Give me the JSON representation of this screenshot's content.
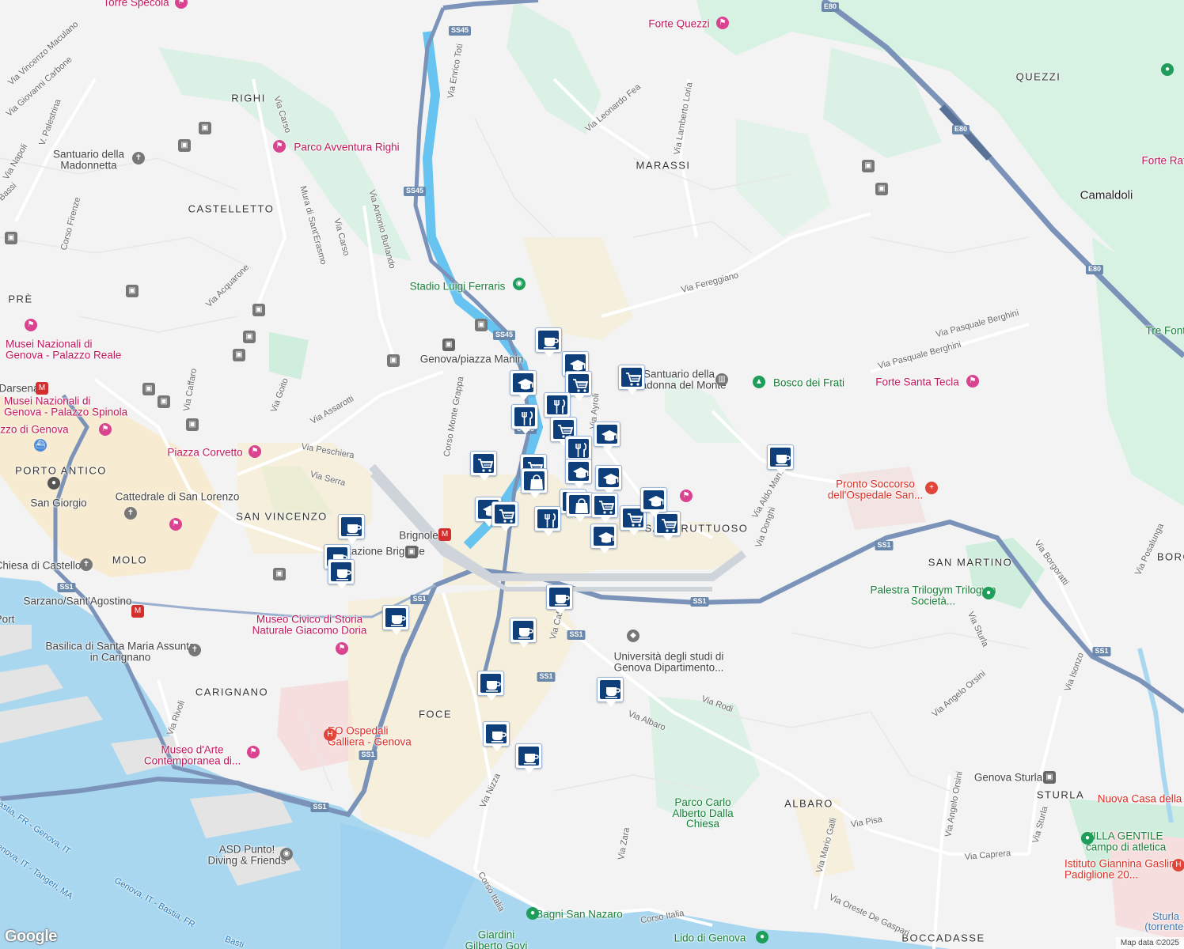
{
  "map": {
    "provider_logo": "Google",
    "copyright": "Map data ©2025",
    "colors": {
      "land": "#f3f3f3",
      "water": "#a9d7f0",
      "water_inner": "#67c3ef",
      "park": "#cfeedd",
      "urban": "#f7ecd1",
      "highway": "#7b93b8",
      "road": "#ffffff",
      "marker": "#0f3f7a",
      "hospital": "#f6dede"
    }
  },
  "labels": {
    "areas": [
      "RIGHI",
      "CASTELLETTO",
      "PRÈ",
      "MARASSI",
      "QUEZZI",
      "PORTO ANTICO",
      "SAN VINCENZO",
      "MOLO",
      "CARIGNANO",
      "FOCE",
      "SAN MARTINO",
      "ALBARO",
      "STURLA",
      "BOCCADASSE",
      "BORG",
      "SAN FRUTTUOSO"
    ],
    "cities": [
      "Camaldoli"
    ],
    "streets": [
      "Via Vincenzo Maculano",
      "Via Giovanni Carbone",
      "V. Palestrina",
      "Via Napoli",
      "Bassi",
      "Via Carso",
      "Corso Firenze",
      "Mura di Sant'Erasmo",
      "Via Carso",
      "Via Antonio Burlando",
      "Via Enrico Toti",
      "Via Leonardo Fea",
      "Via Lamberto Loria",
      "Via Acquarone",
      "Via Caffaro",
      "Via Goito",
      "Via Assarotti",
      "Via Peschiera",
      "Via Serra",
      "Corso Monte Grappa",
      "Via Fereggiano",
      "Via Pasquale Berghini",
      "Via Pasquale Berghini",
      "Via Aldo Manuzio",
      "Via Donghi",
      "Via Sturla",
      "Via Angelo Orsini",
      "Via Isonzo",
      "Via Posalunga",
      "Via Borgoratti",
      "Via Rodi",
      "Via Albaro",
      "Via Nizza",
      "Via Rivoli",
      "Via Zara",
      "Via Mario Galli",
      "Via Pisa",
      "Via Caprera",
      "Via Oreste De Gaspari",
      "Via Sturla",
      "Via Angelo Orsini",
      "Corso Italia",
      "Corso Italia",
      "Via Ayroli",
      "Via Caff"
    ],
    "ferries": [
      "Bastia, FR - Genova, IT",
      "Genova, IT - Tangeri, MA",
      "Genova, IT - Bastia, FR",
      "Basti"
    ],
    "pois_pink": [
      "Torre Specola",
      "Forte Quezzi",
      "Parco Avventura Righi",
      "Musei Nazionali di Genova - Palazzo Reale",
      "Musei Nazionali di Genova - Palazzo Spinola",
      "Palazzo di Genova",
      "Piazza Corvetto",
      "Forte Santa Tecla",
      "Museo Civico di Storia Naturale Giacomo Doria",
      "Museo d'Arte Contemporanea di...",
      "Forte Ratti"
    ],
    "pois_dark": [
      "Santuario della Madonnetta",
      "Santuario della Madonna del Monte",
      "Cattedrale di San Lorenzo",
      "Basilica di Santa Maria Assunta in Carignano",
      "Chiesa di Castello",
      "Sarzano/Sant'Agostino",
      "San Giorgio",
      "Darsena",
      "Genova/piazza Manin",
      "Brignole",
      "Stazione Brignole",
      "Università degli studi di Genova Dipartimento...",
      "ASD Punto! Diving & Friends",
      "Genova Sturla",
      "Port"
    ],
    "pois_green": [
      "Stadio Luigi Ferraris",
      "Bosco dei Frati",
      "Palestra Trilogym Trilogym Società...",
      "Parco Carlo Alberto Dalla Chiesa",
      "Bagni San Nazaro",
      "Lido di Genova",
      "VILLA GENTILE campo di atletica",
      "Giardini Gilberto Govi",
      "Tre Fontane"
    ],
    "pois_red": [
      "Pronto Soccorso dell'Ospedale San...",
      "EO Ospedali Galliera - Genova",
      "Nuova Casa della",
      "Istituto Giannina Gaslini Padiglione 20..."
    ],
    "water": [
      "Sturla (torrente)"
    ],
    "shields": [
      "SS45",
      "SS45",
      "SS45",
      "SS45",
      "SS1",
      "SS1",
      "SS1",
      "SS1",
      "SS1",
      "SS1",
      "SS1",
      "SS1",
      "E80",
      "E80",
      "E80"
    ]
  },
  "markers": [
    {
      "type": "cafe-icon"
    },
    {
      "type": "school-icon"
    },
    {
      "type": "cart-icon"
    },
    {
      "type": "cart-icon"
    },
    {
      "type": "school-icon"
    },
    {
      "type": "restaurant-icon"
    },
    {
      "type": "restaurant-icon"
    },
    {
      "type": "cart-icon"
    },
    {
      "type": "school-icon"
    },
    {
      "type": "restaurant-icon"
    },
    {
      "type": "school-icon"
    },
    {
      "type": "cart-icon"
    },
    {
      "type": "cart-icon"
    },
    {
      "type": "shopping-bag-icon"
    },
    {
      "type": "school-icon"
    },
    {
      "type": "cart-icon"
    },
    {
      "type": "school-icon"
    },
    {
      "type": "restaurant-icon"
    },
    {
      "type": "shopping-bag-icon"
    },
    {
      "type": "cart-icon"
    },
    {
      "type": "school-icon"
    },
    {
      "type": "cart-icon"
    },
    {
      "type": "cart-icon"
    },
    {
      "type": "school-icon"
    },
    {
      "type": "cafe-icon"
    },
    {
      "type": "cafe-icon"
    },
    {
      "type": "cafe-icon"
    },
    {
      "type": "cafe-icon"
    },
    {
      "type": "cafe-icon"
    },
    {
      "type": "cafe-icon"
    },
    {
      "type": "cafe-icon"
    },
    {
      "type": "cafe-icon"
    },
    {
      "type": "cafe-icon"
    },
    {
      "type": "cafe-icon"
    },
    {
      "type": "cafe-icon"
    },
    {
      "type": "cart-icon"
    }
  ]
}
